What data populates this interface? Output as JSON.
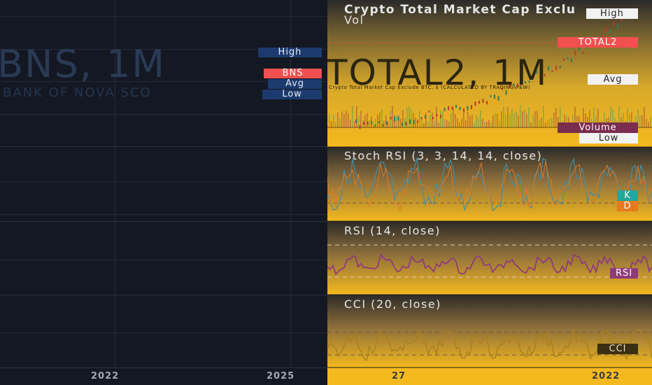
{
  "left_chart": {
    "watermark_symbol": "BNS, 1M",
    "watermark_name": "BANK OF NOVA SCO",
    "tags": {
      "high": "High",
      "symbol": "BNS",
      "avg": "Avg",
      "low": "Low"
    },
    "x_labels": [
      "2022",
      "2025"
    ]
  },
  "right_chart": {
    "title": "Crypto Total Market Cap Exclu",
    "vol_label": "Vol",
    "watermark_symbol": "TOTAL2, 1M",
    "watermark_name": "Crypto Total Market Cap Exclude BTC, $ (CALCULATED BY TRADINGVIEW)",
    "tags": {
      "high": "High",
      "total2": "TOTAL2",
      "avg": "Avg",
      "volume": "Volume",
      "low": "Low"
    },
    "panes": {
      "stoch_title": "Stoch RSI (3, 3, 14, 14, close)",
      "stoch_k": "K",
      "stoch_d": "D",
      "rsi_title": "RSI (14, close)",
      "rsi_tag": "RSI",
      "cci_title": "CCI (20, close)",
      "cci_tag": "CCI"
    },
    "x_labels": [
      "27",
      "2022"
    ]
  },
  "colors": {
    "bg_dark": "#131722",
    "gold": "#f4b91e",
    "red_tag": "#f0504f",
    "navy_tag": "#1c3a6e",
    "rsi_purple": "#8e3b7a",
    "stoch_k": "#26a69a",
    "stoch_d": "#e87a1d",
    "volume_tag": "#7a2d4e"
  }
}
